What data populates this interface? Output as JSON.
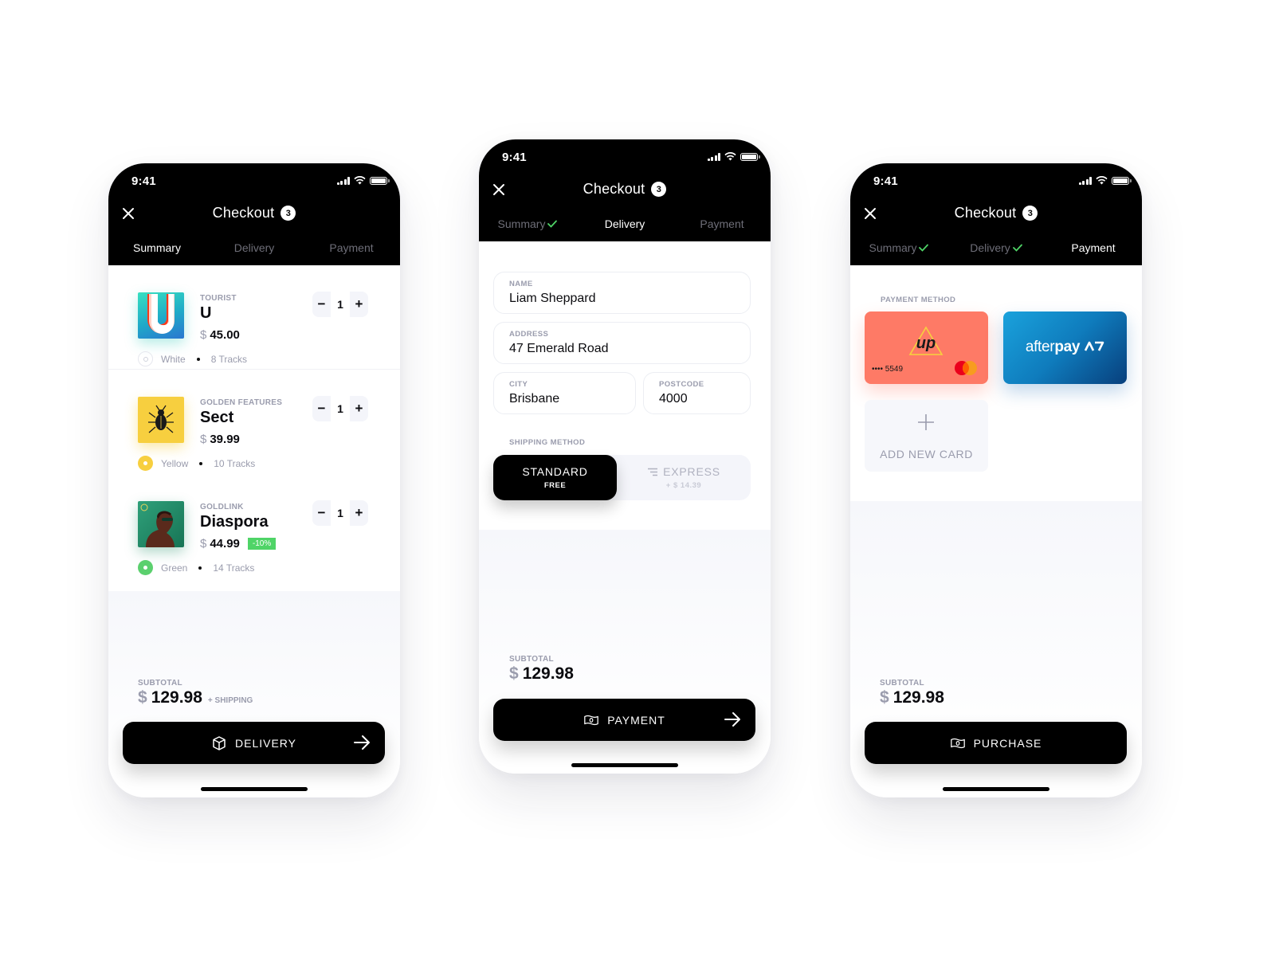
{
  "status_bar": {
    "time": "9:41"
  },
  "header": {
    "title": "Checkout",
    "cart_count": "3"
  },
  "tabs": [
    "Summary",
    "Delivery",
    "Payment"
  ],
  "colors": {
    "accent_check": "#4fd467",
    "discount": "#4fd467",
    "up_card": "#fe7a66",
    "afterpay_blue": "#1aa2dc"
  },
  "summary_screen": {
    "items": [
      {
        "artist": "TOURIST",
        "album": "U",
        "currency": "$",
        "price": "45.00",
        "color": "White",
        "tracks": "8 Tracks",
        "quantity": "1",
        "discount": null,
        "cover": "u-cover"
      },
      {
        "artist": "GOLDEN FEATURES",
        "album": "Sect",
        "currency": "$",
        "price": "39.99",
        "color": "Yellow",
        "tracks": "10 Tracks",
        "quantity": "1",
        "discount": null,
        "cover": "beetle-cover"
      },
      {
        "artist": "GOLDLINK",
        "album": "Diaspora",
        "currency": "$",
        "price": "44.99",
        "color": "Green",
        "tracks": "14 Tracks",
        "quantity": "1",
        "discount": "-10%",
        "cover": "portrait-cover"
      }
    ],
    "subtotal_label": "SUBTOTAL",
    "currency": "$",
    "subtotal": "129.98",
    "shipping_note": "+ SHIPPING",
    "cta_label": "DELIVERY"
  },
  "delivery_screen": {
    "fields": {
      "name": {
        "label": "NAME",
        "value": "Liam Sheppard"
      },
      "address": {
        "label": "ADDRESS",
        "value": "47 Emerald Road"
      },
      "city": {
        "label": "CITY",
        "value": "Brisbane"
      },
      "postcode": {
        "label": "POSTCODE",
        "value": "4000"
      }
    },
    "shipping_method_label": "SHIPPING METHOD",
    "shipping_options": [
      {
        "name": "STANDARD",
        "sub": "FREE",
        "selected": true
      },
      {
        "name": "EXPRESS",
        "sub": "+ $ 14.39",
        "selected": false
      }
    ],
    "subtotal_label": "SUBTOTAL",
    "currency": "$",
    "subtotal": "129.98",
    "cta_label": "PAYMENT"
  },
  "payment_screen": {
    "payment_method_label": "PAYMENT METHOD",
    "cards": [
      {
        "brand": "up",
        "masked_number": "•••• 5549",
        "network": "mastercard"
      },
      {
        "brand_prefix": "after",
        "brand_suffix": "pay"
      }
    ],
    "add_card_label": "ADD NEW CARD",
    "subtotal_label": "SUBTOTAL",
    "currency": "$",
    "subtotal": "129.98",
    "cta_label": "PURCHASE"
  }
}
